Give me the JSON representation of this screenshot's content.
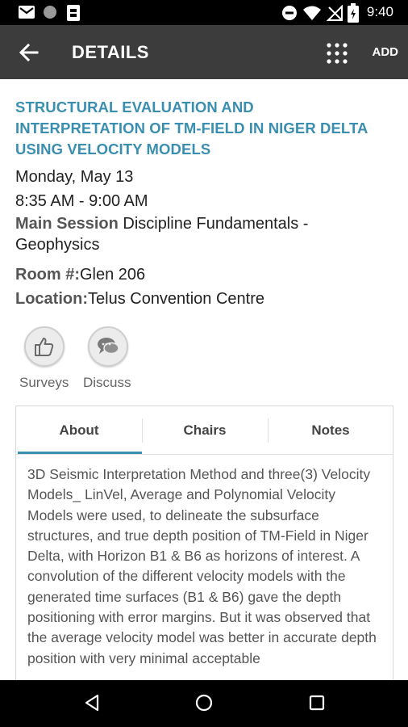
{
  "status_bar": {
    "time": "9:40",
    "icons": [
      "gmail-icon",
      "dot-icon",
      "sim-icon",
      "do-not-disturb-icon",
      "wifi-icon",
      "no-signal-icon",
      "battery-icon"
    ]
  },
  "toolbar": {
    "title": "DETAILS",
    "add_label": "ADD",
    "icons": [
      "back-arrow-icon",
      "grid-menu-icon"
    ]
  },
  "session": {
    "title": "STRUCTURAL EVALUATION AND INTERPRETATION OF TM-FIELD IN NIGER DELTA USING VELOCITY MODELS",
    "date": "Monday, May 13",
    "time": "8:35 AM - 9:00 AM",
    "session_label": "Main Session",
    "session_value": " Discipline Fundamentals - Geophysics",
    "room_label": "Room #:",
    "room_value": "Glen 206",
    "location_label": "Location:",
    "location_value": "Telus Convention Centre"
  },
  "actions": [
    {
      "label": "Surveys",
      "icon": "thumbs-up-icon"
    },
    {
      "label": "Discuss",
      "icon": "chat-bubbles-icon"
    }
  ],
  "tabs": {
    "items": [
      {
        "label": "About",
        "selected": true
      },
      {
        "label": "Chairs",
        "selected": false
      },
      {
        "label": "Notes",
        "selected": false
      }
    ],
    "about_text": "3D Seismic Interpretation Method and three(3) Velocity Models_ LinVel, Average and Polynomial Velocity Models were used, to delineate the subsurface structures, and true depth position of TM-Field in Niger Delta, with Horizon B1 & B6 as horizons of interest. A convolution of the different velocity models with the generated time surfaces (B1 & B6) gave the depth positioning with error margins. But it was observed that the average velocity model was better in accurate depth position with very minimal acceptable"
  },
  "colors": {
    "accent": "#3a8fb0",
    "toolbar": "#3c3c3c",
    "status_bar": "#000000"
  },
  "nav_bar": {
    "icons": [
      "back-triangle-icon",
      "home-circle-icon",
      "recents-square-icon"
    ]
  }
}
